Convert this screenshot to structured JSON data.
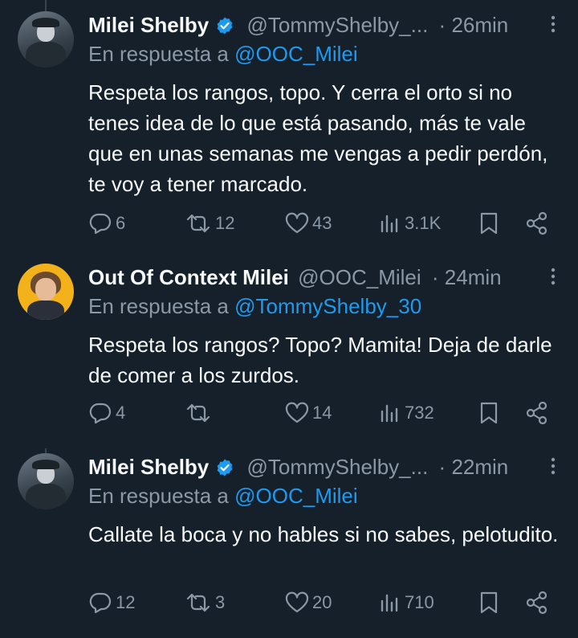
{
  "tweets": [
    {
      "name": "Milei Shelby",
      "verified": true,
      "handle": "@TommyShelby_...",
      "separator": "·",
      "time": "26min",
      "reply_prefix": "En respuesta a",
      "reply_to": "@OOC_Milei",
      "text": "Respeta los rangos, topo. Y cerra el orto si no tenes idea de lo que está pasando, más te vale que en unas semanas me vengas a pedir perdón, te voy a tener marcado.",
      "replies": "6",
      "retweets": "12",
      "likes": "43",
      "views": "3.1K"
    },
    {
      "name": "Out Of Context Milei",
      "verified": false,
      "handle": "@OOC_Milei",
      "separator": "·",
      "time": "24min",
      "reply_prefix": "En respuesta a",
      "reply_to": "@TommyShelby_30",
      "text": "Respeta los rangos? Topo? Mamita! Deja de darle de comer a los zurdos.",
      "replies": "4",
      "retweets": "",
      "likes": "14",
      "views": "732"
    },
    {
      "name": "Milei Shelby",
      "verified": true,
      "handle": "@TommyShelby_...",
      "separator": "·",
      "time": "22min",
      "reply_prefix": "En respuesta a",
      "reply_to": "@OOC_Milei",
      "text": "Callate la boca y no hables si no sabes, pelotudito.",
      "replies": "12",
      "retweets": "3",
      "likes": "20",
      "views": "710"
    }
  ],
  "icons": {
    "reply": "reply-icon",
    "retweet": "retweet-icon",
    "like": "heart-icon",
    "views": "views-icon",
    "bookmark": "bookmark-icon",
    "share": "share-icon",
    "more": "more-options-icon",
    "verified": "verified-badge-icon"
  },
  "colors": {
    "background": "#15202b",
    "text": "#f7f9f9",
    "secondary": "#8b98a5",
    "link": "#1d9bf0",
    "thread_line": "#38444d"
  }
}
